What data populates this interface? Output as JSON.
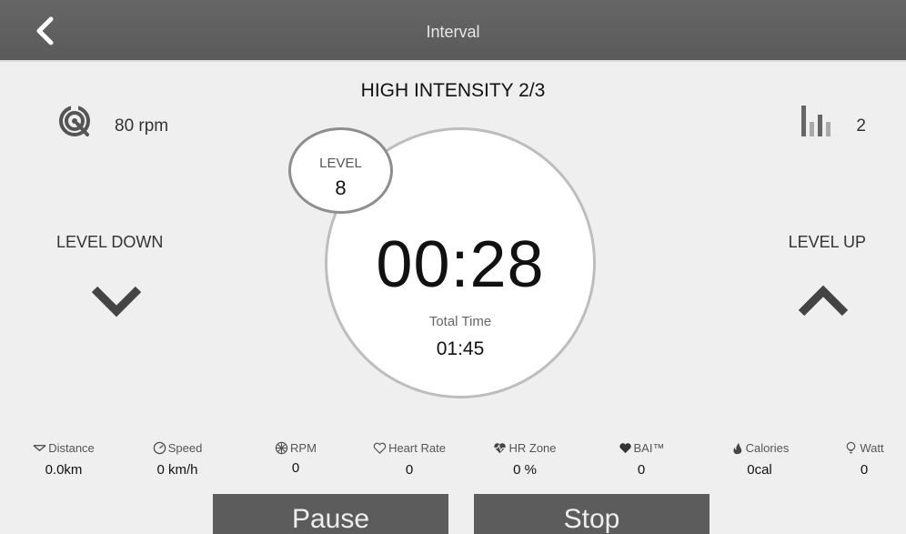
{
  "header": {
    "title": "Interval"
  },
  "segment": {
    "title": "HIGH INTENSITY 2/3"
  },
  "cadence": {
    "value": "80 rpm"
  },
  "profile": {
    "value": "2"
  },
  "controls": {
    "level_down_label": "LEVEL DOWN",
    "level_up_label": "LEVEL UP"
  },
  "level": {
    "label": "LEVEL",
    "value": "8"
  },
  "timer": {
    "remaining": "00:28",
    "total_label": "Total Time",
    "total_value": "01:45"
  },
  "stats": [
    {
      "label": "Distance",
      "value": "0.0km",
      "icon": "distance-icon"
    },
    {
      "label": "Speed",
      "value": "0 km/h",
      "icon": "speed-icon"
    },
    {
      "label": "RPM",
      "value": "0",
      "icon": "rpm-icon"
    },
    {
      "label": "Heart Rate",
      "value": "0",
      "icon": "heart-icon"
    },
    {
      "label": "HR Zone",
      "value": "0 %",
      "icon": "hr-zone-icon"
    },
    {
      "label": "BAI™",
      "value": "0",
      "icon": "bai-icon"
    },
    {
      "label": "Calories",
      "value": "0cal",
      "icon": "flame-icon"
    },
    {
      "label": "Watt",
      "value": "0",
      "icon": "bulb-icon"
    }
  ],
  "buttons": {
    "pause": "Pause",
    "stop": "Stop"
  },
  "colors": {
    "header": "#5a5a5a",
    "background": "#efefef",
    "button": "#5c5c5c"
  }
}
